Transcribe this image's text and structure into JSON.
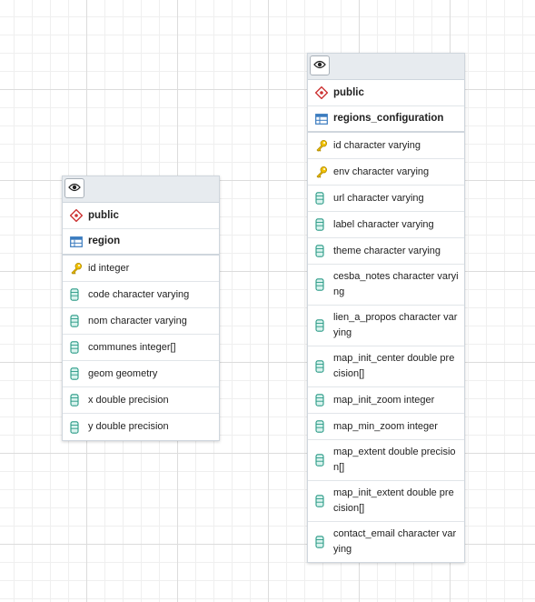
{
  "tables": {
    "region": {
      "schema": "public",
      "name": "region",
      "columns": [
        {
          "label": "id integer",
          "icon": "primary-key-icon"
        },
        {
          "label": "code character varying",
          "icon": "column-icon"
        },
        {
          "label": "nom character varying",
          "icon": "column-icon"
        },
        {
          "label": "communes integer[]",
          "icon": "column-icon"
        },
        {
          "label": "geom geometry",
          "icon": "column-icon"
        },
        {
          "label": "x double precision",
          "icon": "column-icon"
        },
        {
          "label": "y double precision",
          "icon": "column-icon"
        }
      ]
    },
    "regions_configuration": {
      "schema": "public",
      "name": "regions_configuration",
      "columns": [
        {
          "label": "id character varying",
          "icon": "primary-key-icon"
        },
        {
          "label": "env character varying",
          "icon": "primary-key-icon"
        },
        {
          "label": "url character varying",
          "icon": "column-icon"
        },
        {
          "label": "label character varying",
          "icon": "column-icon"
        },
        {
          "label": "theme character varying",
          "icon": "column-icon"
        },
        {
          "label": "cesba_notes character varying",
          "icon": "column-icon"
        },
        {
          "label": "lien_a_propos character varying",
          "icon": "column-icon"
        },
        {
          "label": "map_init_center double precision[]",
          "icon": "column-icon"
        },
        {
          "label": "map_init_zoom integer",
          "icon": "column-icon"
        },
        {
          "label": "map_min_zoom integer",
          "icon": "column-icon"
        },
        {
          "label": "map_extent double precision[]",
          "icon": "column-icon"
        },
        {
          "label": "map_init_extent double precision[]",
          "icon": "column-icon"
        },
        {
          "label": "contact_email character varying",
          "icon": "column-icon"
        }
      ]
    }
  },
  "colors": {
    "schema_icon": "#cc3333",
    "table_icon": "#3a7bbf",
    "key_icon": "#d9a400",
    "column_icon": "#2a9a86"
  }
}
